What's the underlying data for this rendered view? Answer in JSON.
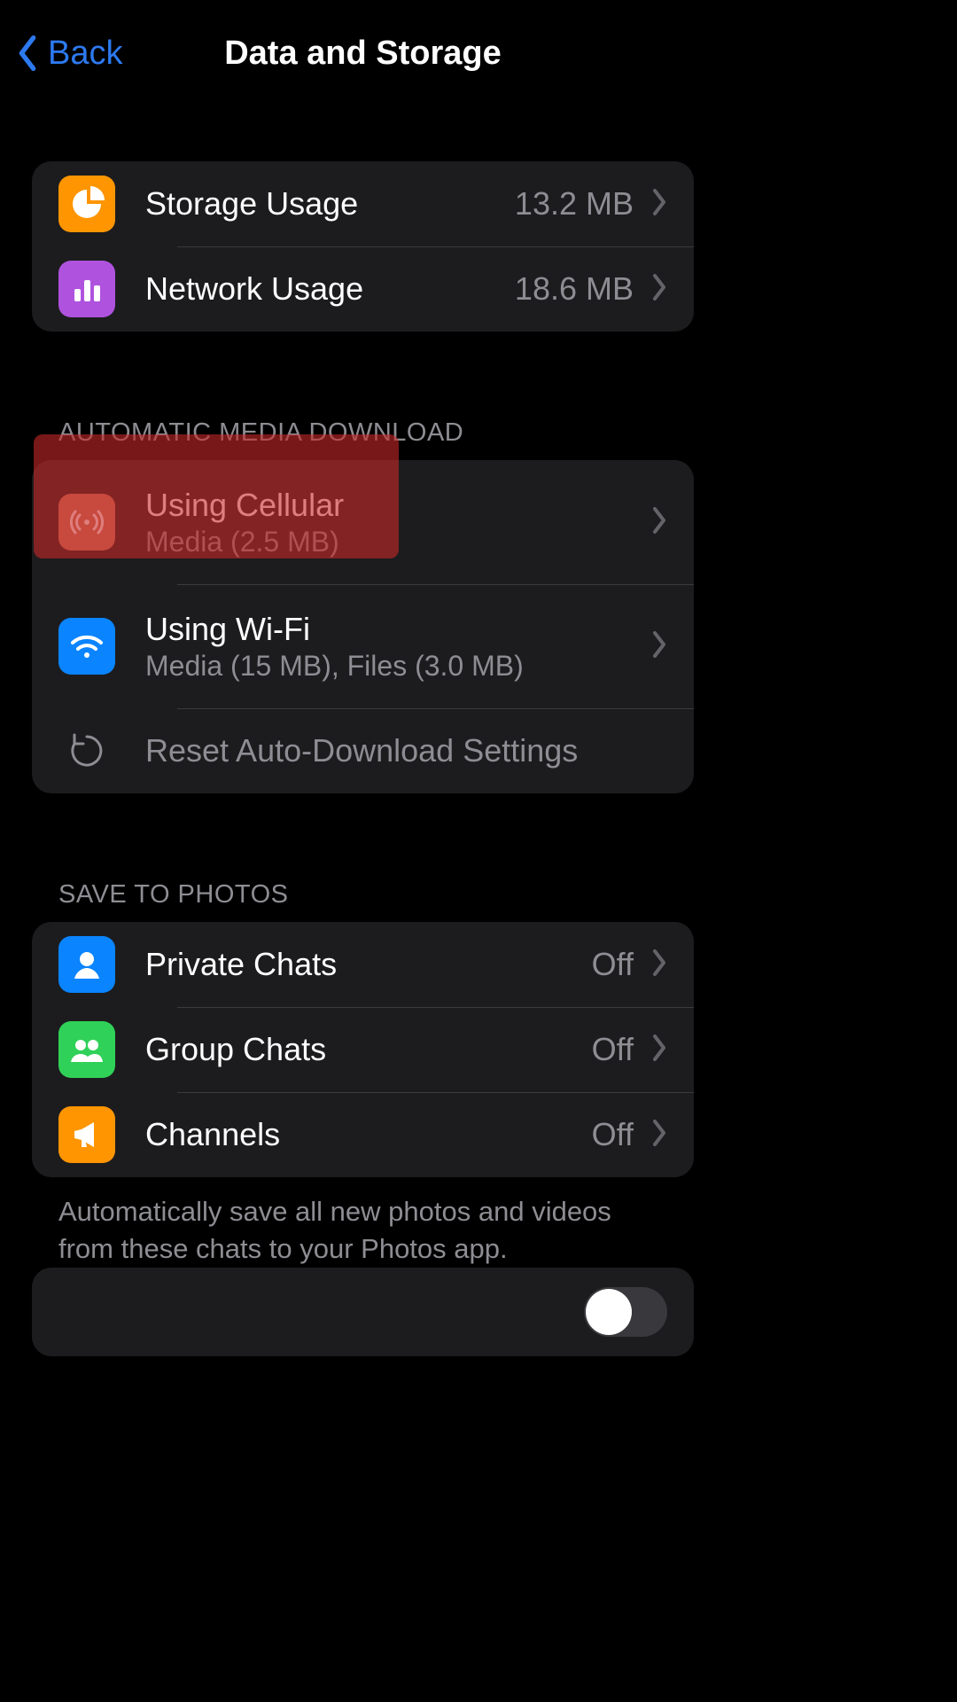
{
  "header": {
    "back_label": "Back",
    "title": "Data and Storage"
  },
  "usage": {
    "storage": {
      "label": "Storage Usage",
      "value": "13.2 MB"
    },
    "network": {
      "label": "Network Usage",
      "value": "18.6 MB"
    }
  },
  "auto": {
    "header": "AUTOMATIC MEDIA DOWNLOAD",
    "cellular": {
      "label": "Using Cellular",
      "sub": "Media (2.5 MB)"
    },
    "wifi": {
      "label": "Using Wi-Fi",
      "sub": "Media (15 MB), Files (3.0 MB)"
    },
    "reset": {
      "label": "Reset Auto-Download Settings"
    }
  },
  "save": {
    "header": "SAVE TO PHOTOS",
    "private": {
      "label": "Private Chats",
      "value": "Off"
    },
    "group": {
      "label": "Group Chats",
      "value": "Off"
    },
    "channels": {
      "label": "Channels",
      "value": "Off"
    },
    "footer": "Automatically save all new photos and videos from these chats to your Photos app."
  }
}
